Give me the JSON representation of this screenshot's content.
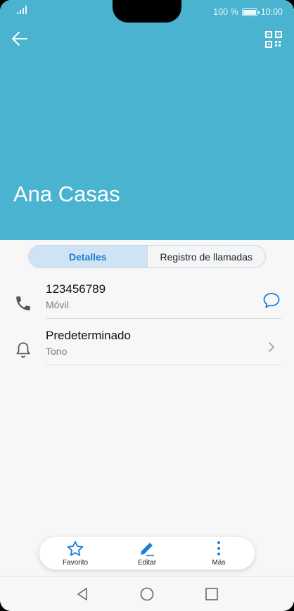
{
  "status_bar": {
    "battery_text": "100 %",
    "time": "10:00"
  },
  "header": {
    "contact_name": "Ana Casas",
    "icons": {
      "back": "arrow-left-icon",
      "qr": "qr-code-icon"
    },
    "background_color": "#4ab3cf"
  },
  "tabs": [
    {
      "label": "Detalles",
      "active": true
    },
    {
      "label": "Registro de llamadas",
      "active": false
    }
  ],
  "details": [
    {
      "primary": "123456789",
      "secondary": "Móvil",
      "icon": "phone-icon",
      "action_icon": "message-icon"
    },
    {
      "primary": "Predeterminado",
      "secondary": "Tono",
      "icon": "bell-icon",
      "action_icon": "chevron-right-icon"
    }
  ],
  "actions": [
    {
      "label": "Favorito",
      "icon": "star-icon"
    },
    {
      "label": "Editar",
      "icon": "pencil-icon"
    },
    {
      "label": "Más",
      "icon": "more-vertical-icon"
    }
  ],
  "nav_bar": {
    "icons": [
      "back-triangle-icon",
      "home-circle-icon",
      "recents-square-icon"
    ]
  },
  "colors": {
    "accent": "#1a7fd9",
    "tab_active_bg": "#cfe3f4"
  }
}
